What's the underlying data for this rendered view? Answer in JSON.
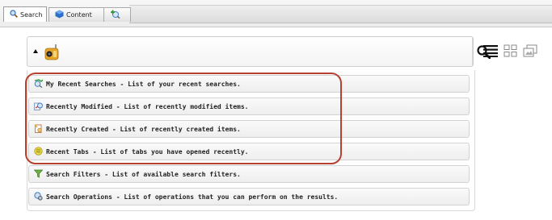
{
  "tabs": [
    {
      "label": "Search",
      "icon": "search-icon",
      "active": true
    },
    {
      "label": "Content",
      "icon": "cube-icon",
      "active": false
    },
    {
      "label": "",
      "icon": "add-tab-icon",
      "active": false
    }
  ],
  "search_bar": {
    "caret_icon": "caret-up-icon",
    "mode_icon": "radio-icon",
    "search_icon": "magnifier-icon"
  },
  "view_icons": [
    "list-view-icon",
    "grid-view-icon",
    "gallery-view-icon"
  ],
  "menu_items": [
    {
      "icon": "recent-searches-icon",
      "text": "My Recent Searches - List of your recent searches."
    },
    {
      "icon": "recently-modified-icon",
      "text": "Recently Modified - List of recently modified items."
    },
    {
      "icon": "recently-created-icon",
      "text": "Recently Created - List of recently created items."
    },
    {
      "icon": "recent-tabs-icon",
      "text": "Recent Tabs - List of tabs you have opened recently."
    },
    {
      "icon": "search-filters-icon",
      "text": "Search Filters - List of available search filters."
    },
    {
      "icon": "search-operations-icon",
      "text": "Search Operations - List of operations that you can perform on the results."
    }
  ],
  "colors": {
    "highlight_border": "#b5412f",
    "accent_blue": "#2a6fc9"
  }
}
